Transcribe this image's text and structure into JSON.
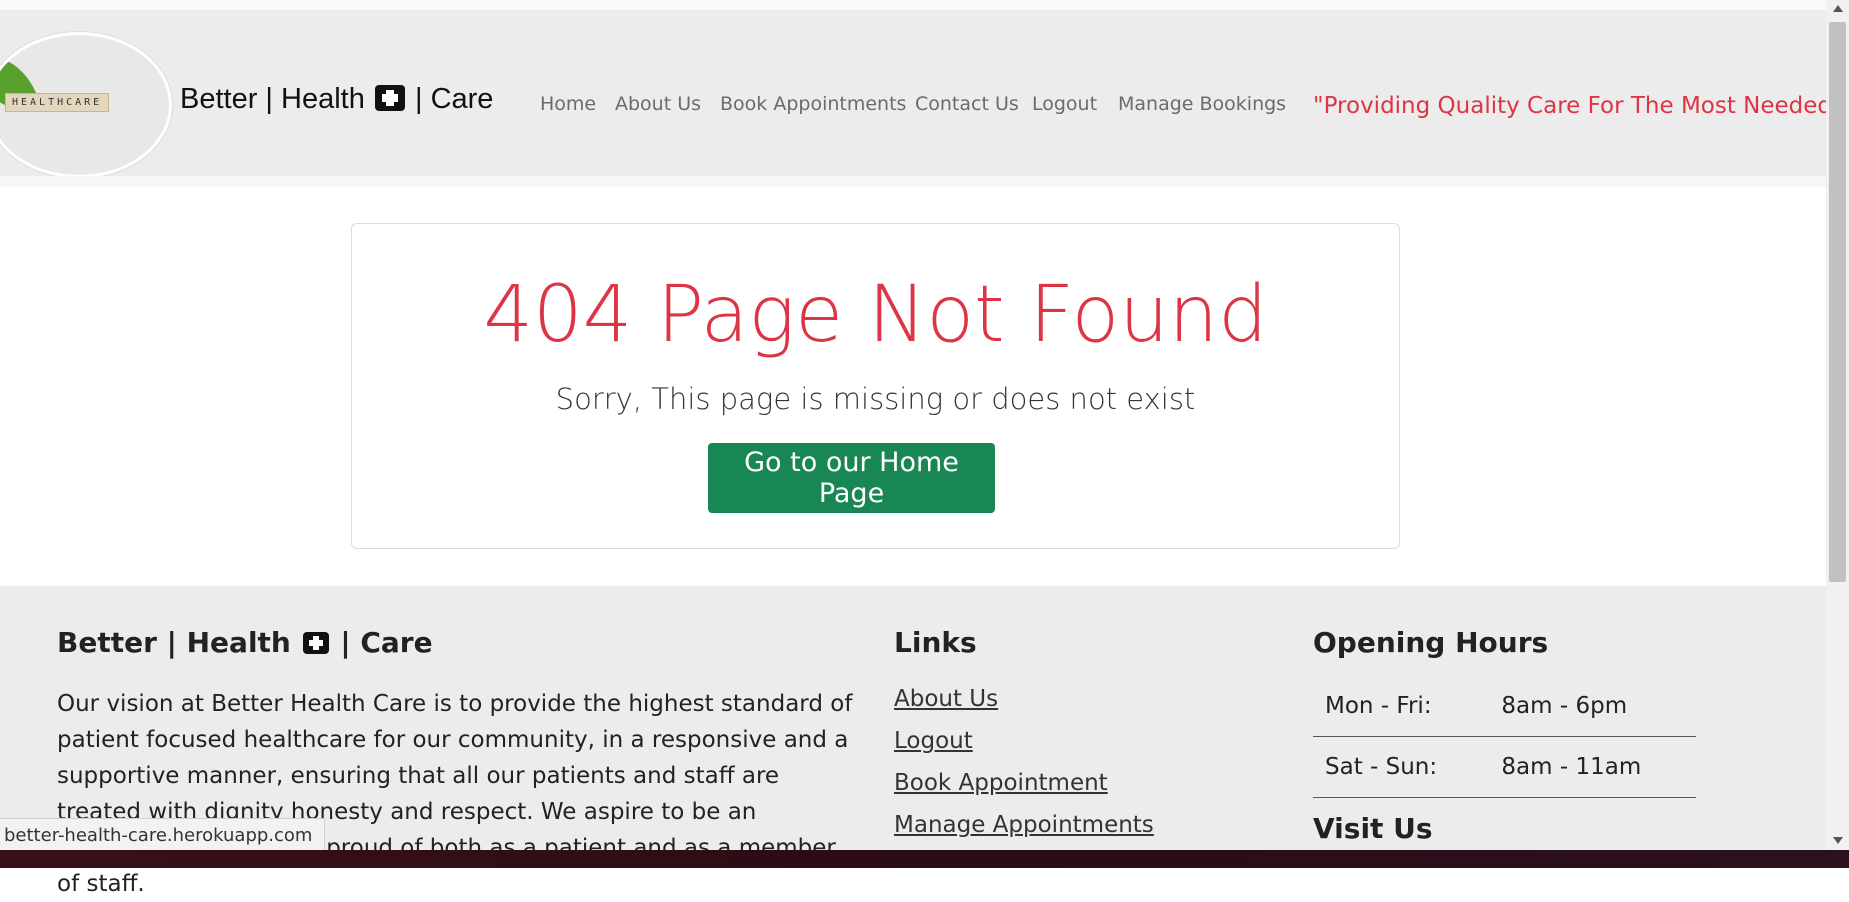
{
  "brand": {
    "logo_text": "HEALTHCARE",
    "name_part1": "Better | Health",
    "name_part2": "| Care",
    "icon": "medical-kit-icon"
  },
  "nav": {
    "items": [
      {
        "label": "Home"
      },
      {
        "label": "About Us"
      },
      {
        "label": "Book Appointments"
      },
      {
        "label": "Contact Us"
      },
      {
        "label": "Logout"
      },
      {
        "label": "Manage Bookings"
      }
    ],
    "slogan": "\"Providing Quality Care For The Most Needed\""
  },
  "error_card": {
    "title": "404 Page Not Found",
    "subtitle": "Sorry, This page is missing or does not exist",
    "button_label": "Go to our Home Page"
  },
  "footer": {
    "about": {
      "heading_part1": "Better | Health",
      "heading_part2": "| Care",
      "text": "Our vision at Better Health Care is to provide the highest standard of patient focused healthcare for our community, in a responsive and a supportive manner, ensuring that all our patients and staff are treated with dignity honesty and respect. We aspire to be an organisation we are all proud of both as a patient and as a member of staff."
    },
    "links": {
      "heading": "Links",
      "items": [
        {
          "label": "About Us"
        },
        {
          "label": "Logout"
        },
        {
          "label": "Book Appointment"
        },
        {
          "label": "Manage Appointments"
        }
      ]
    },
    "hours": {
      "heading": "Opening Hours",
      "rows": [
        {
          "day": "Mon - Fri:",
          "time": "8am - 6pm"
        },
        {
          "day": "Sat - Sun:",
          "time": "8am - 11am"
        }
      ]
    },
    "visit": {
      "heading": "Visit Us"
    }
  },
  "status_bar": {
    "url": "better-health-care.herokuapp.com"
  },
  "colors": {
    "accent_red": "#dc3545",
    "button_green": "#198754",
    "nav_bg": "#ececec"
  }
}
